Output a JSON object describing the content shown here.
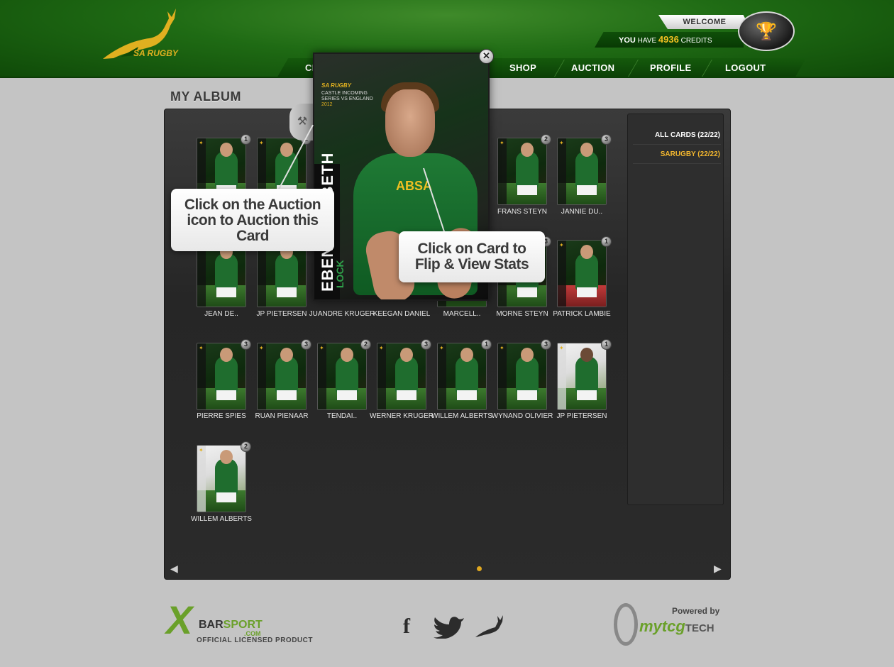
{
  "header": {
    "logo_text": "SA RUGBY",
    "welcome_label": "WELCOME",
    "credits_prefix_bold": "YOU",
    "credits_prefix": "HAVE",
    "credits_value": "4936",
    "credits_suffix": "CREDITS",
    "nav": [
      {
        "label": "CI"
      },
      {
        "label": "SHOP"
      },
      {
        "label": "AUCTION"
      },
      {
        "label": "PROFILE"
      },
      {
        "label": "LOGOUT"
      }
    ]
  },
  "page_title": "MY ALBUM",
  "sidebar": {
    "items": [
      {
        "label": "ALL CARDS (22/22)",
        "active": false
      },
      {
        "label": "SARUGBY (22/22)",
        "active": true
      }
    ]
  },
  "cards": [
    {
      "name": "",
      "count": "1"
    },
    {
      "name": "",
      "count": "1"
    },
    {
      "name": "FRANS STEYN",
      "count": "2"
    },
    {
      "name": "JANNIE DU..",
      "count": "3"
    },
    {
      "name": "JEAN DE..",
      "count": ""
    },
    {
      "name": "JP PIETERSEN",
      "count": ""
    },
    {
      "name": "JUANDRE KRUGER",
      "count": ""
    },
    {
      "name": "KEEGAN DANIEL",
      "count": ""
    },
    {
      "name": "MARCELL..",
      "count": ""
    },
    {
      "name": "MORNE STEYN",
      "count": "3"
    },
    {
      "name": "PATRICK LAMBIE",
      "count": "1"
    },
    {
      "name": "PIERRE SPIES",
      "count": "3"
    },
    {
      "name": "RUAN PIENAAR",
      "count": "3"
    },
    {
      "name": "TENDAI..",
      "count": "2"
    },
    {
      "name": "WERNER KRUGER",
      "count": "3"
    },
    {
      "name": "WILLEM ALBERTS",
      "count": "1"
    },
    {
      "name": "WYNAND OLIVIER",
      "count": "3"
    },
    {
      "name": "JP PIETERSEN",
      "count": "1"
    },
    {
      "name": "WILLEM ALBERTS",
      "count": "2"
    }
  ],
  "big_card": {
    "brand": "SA RUGBY",
    "series_line1": "CASTLE INCOMING",
    "series_line2": "SERIES VS ENGLAND",
    "year": "2012",
    "name": "EBEN ETZEBETH",
    "position": "LOCK",
    "sponsor": "ABSA"
  },
  "tooltips": {
    "auction": "Click on the Auction icon to Auction this Card",
    "flip": "Click on Card to Flip & View Stats"
  },
  "pager": {
    "prev": "◀",
    "next": "▶"
  },
  "footer": {
    "xbar_x": "X",
    "xbar_bar": "BAR",
    "xbar_sport": "SPORT",
    "xbar_com": ".COM",
    "licensed": "OFFICIAL LICENSED PRODUCT",
    "powered_by": "Powered by",
    "mytcg": "mytcg",
    "tech": "TECH",
    "facebook": "f",
    "twitter": "t"
  },
  "colors": {
    "accent": "#f2b62e",
    "green": "#1f6b14"
  }
}
